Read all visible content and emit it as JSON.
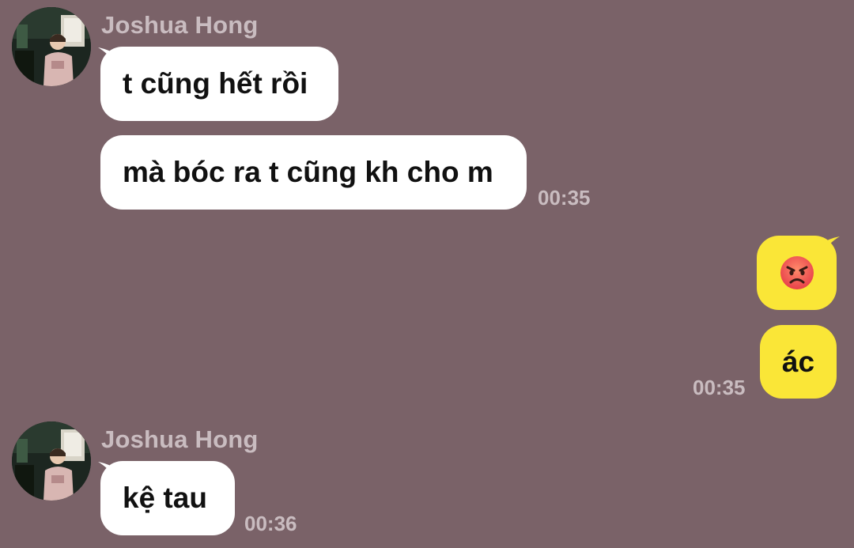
{
  "theme": {
    "background": "#7a6268",
    "incoming_bubble": "#ffffff",
    "outgoing_bubble": "#fae637",
    "meta_text": "#c9bcc0"
  },
  "groups": [
    {
      "sender": "Joshua Hong",
      "avatar_icon": "profile-photo",
      "messages": [
        "t cũng hết rồi",
        "mà bóc ra t cũng kh cho m"
      ],
      "time": "00:35"
    },
    {
      "sender": "me",
      "messages": [
        {
          "type": "emoji",
          "icon": "angry-face-emoji"
        },
        {
          "type": "text",
          "text": "ác"
        }
      ],
      "time": "00:35"
    },
    {
      "sender": "Joshua Hong",
      "avatar_icon": "profile-photo",
      "messages": [
        "kệ tau"
      ],
      "time": "00:36"
    }
  ]
}
